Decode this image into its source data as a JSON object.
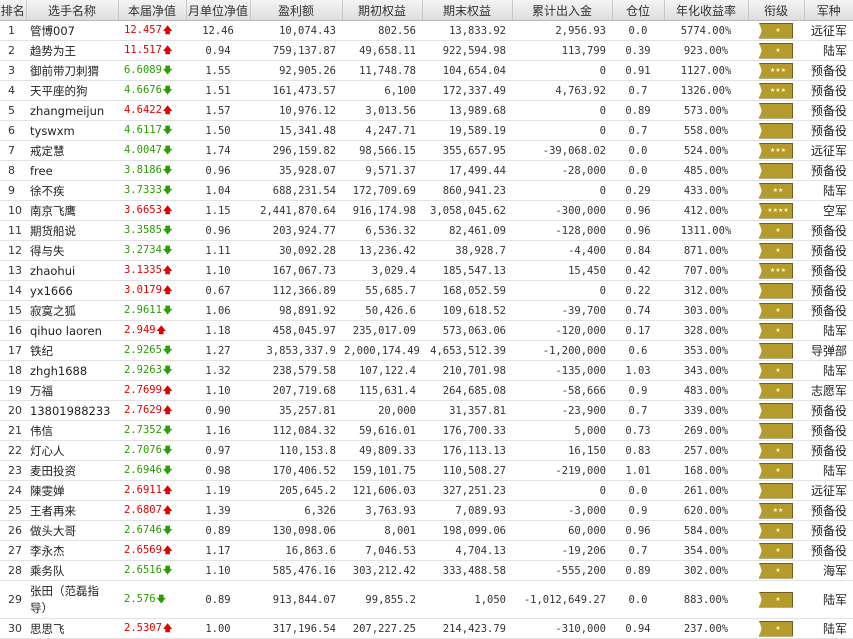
{
  "headers": [
    "排名",
    "选手名称",
    "本届净值",
    "月单位净值",
    "盈利额",
    "期初权益",
    "期末权益",
    "累计出入金",
    "仓位",
    "年化收益率",
    "衔级",
    "军种"
  ],
  "rows": [
    {
      "rank": "1",
      "name": "管博007",
      "nav": "12.457",
      "dir": "up",
      "monthly": "12.46",
      "profit": "10,074.43",
      "start": "802.56",
      "end": "13,833.92",
      "flow": "2,956.93",
      "position": "0.0",
      "annual": "5774.00%",
      "rank_stars": "★",
      "branch": "远征军"
    },
    {
      "rank": "2",
      "name": "趋势为王",
      "nav": "11.517",
      "dir": "up",
      "monthly": "0.94",
      "profit": "759,137.87",
      "start": "49,658.11",
      "end": "922,594.98",
      "flow": "113,799",
      "position": "0.39",
      "annual": "923.00%",
      "rank_stars": "★",
      "branch": "陆军"
    },
    {
      "rank": "3",
      "name": "御前带刀刺猬",
      "nav": "6.6089",
      "dir": "down",
      "monthly": "1.55",
      "profit": "92,905.26",
      "start": "11,748.78",
      "end": "104,654.04",
      "flow": "0",
      "position": "0.91",
      "annual": "1127.00%",
      "rank_stars": "★★★",
      "branch": "预备役"
    },
    {
      "rank": "4",
      "name": "天平座的狗",
      "nav": "4.6676",
      "dir": "down",
      "monthly": "1.51",
      "profit": "161,473.57",
      "start": "6,100",
      "end": "172,337.49",
      "flow": "4,763.92",
      "position": "0.7",
      "annual": "1326.00%",
      "rank_stars": "★★★",
      "branch": "预备役"
    },
    {
      "rank": "5",
      "name": "zhangmeijun",
      "nav": "4.6422",
      "dir": "up",
      "monthly": "1.57",
      "profit": "10,976.12",
      "start": "3,013.56",
      "end": "13,989.68",
      "flow": "0",
      "position": "0.89",
      "annual": "573.00%",
      "rank_stars": "",
      "branch": "预备役"
    },
    {
      "rank": "6",
      "name": "tyswxm",
      "nav": "4.6117",
      "dir": "down",
      "monthly": "1.50",
      "profit": "15,341.48",
      "start": "4,247.71",
      "end": "19,589.19",
      "flow": "0",
      "position": "0.7",
      "annual": "558.00%",
      "rank_stars": "",
      "branch": "预备役"
    },
    {
      "rank": "7",
      "name": "戒定慧",
      "nav": "4.0047",
      "dir": "down",
      "monthly": "1.74",
      "profit": "296,159.82",
      "start": "98,566.15",
      "end": "355,657.95",
      "flow": "-39,068.02",
      "position": "0.0",
      "annual": "524.00%",
      "rank_stars": "★★★",
      "branch": "远征军"
    },
    {
      "rank": "8",
      "name": "free",
      "nav": "3.8186",
      "dir": "down",
      "monthly": "0.96",
      "profit": "35,928.07",
      "start": "9,571.37",
      "end": "17,499.44",
      "flow": "-28,000",
      "position": "0.0",
      "annual": "485.00%",
      "rank_stars": "",
      "branch": "预备役"
    },
    {
      "rank": "9",
      "name": "徐不疾",
      "nav": "3.7333",
      "dir": "down",
      "monthly": "1.04",
      "profit": "688,231.54",
      "start": "172,709.69",
      "end": "860,941.23",
      "flow": "0",
      "position": "0.29",
      "annual": "433.00%",
      "rank_stars": "★★",
      "branch": "陆军"
    },
    {
      "rank": "10",
      "name": "南京飞鹰",
      "nav": "3.6653",
      "dir": "up",
      "monthly": "1.15",
      "profit": "2,441,870.64",
      "start": "916,174.98",
      "end": "3,058,045.62",
      "flow": "-300,000",
      "position": "0.96",
      "annual": "412.00%",
      "rank_stars": "★★★★",
      "branch": "空军"
    },
    {
      "rank": "11",
      "name": "期货船说",
      "nav": "3.3585",
      "dir": "down",
      "monthly": "0.96",
      "profit": "203,924.77",
      "start": "6,536.32",
      "end": "82,461.09",
      "flow": "-128,000",
      "position": "0.96",
      "annual": "1311.00%",
      "rank_stars": "★",
      "branch": "预备役"
    },
    {
      "rank": "12",
      "name": "得与失",
      "nav": "3.2734",
      "dir": "down",
      "monthly": "1.11",
      "profit": "30,092.28",
      "start": "13,236.42",
      "end": "38,928.7",
      "flow": "-4,400",
      "position": "0.84",
      "annual": "871.00%",
      "rank_stars": "★",
      "branch": "预备役"
    },
    {
      "rank": "13",
      "name": "zhaohui",
      "nav": "3.1335",
      "dir": "up",
      "monthly": "1.10",
      "profit": "167,067.73",
      "start": "3,029.4",
      "end": "185,547.13",
      "flow": "15,450",
      "position": "0.42",
      "annual": "707.00%",
      "rank_stars": "★★★",
      "branch": "预备役"
    },
    {
      "rank": "14",
      "name": "yx1666",
      "nav": "3.0179",
      "dir": "up",
      "monthly": "0.67",
      "profit": "112,366.89",
      "start": "55,685.7",
      "end": "168,052.59",
      "flow": "0",
      "position": "0.22",
      "annual": "312.00%",
      "rank_stars": "",
      "branch": "预备役"
    },
    {
      "rank": "15",
      "name": "寂寞之狐",
      "nav": "2.9611",
      "dir": "down",
      "monthly": "1.06",
      "profit": "98,891.92",
      "start": "50,426.6",
      "end": "109,618.52",
      "flow": "-39,700",
      "position": "0.74",
      "annual": "303.00%",
      "rank_stars": "★",
      "branch": "预备役"
    },
    {
      "rank": "16",
      "name": "qihuo laoren",
      "nav": "2.949",
      "dir": "up",
      "monthly": "1.18",
      "profit": "458,045.97",
      "start": "235,017.09",
      "end": "573,063.06",
      "flow": "-120,000",
      "position": "0.17",
      "annual": "328.00%",
      "rank_stars": "★",
      "branch": "陆军"
    },
    {
      "rank": "17",
      "name": "铁纪",
      "nav": "2.9265",
      "dir": "down",
      "monthly": "1.27",
      "profit": "3,853,337.9",
      "start": "2,000,174.49",
      "end": "4,653,512.39",
      "flow": "-1,200,000",
      "position": "0.6",
      "annual": "353.00%",
      "rank_stars": "",
      "branch": "导弹部"
    },
    {
      "rank": "18",
      "name": "zhgh1688",
      "nav": "2.9263",
      "dir": "down",
      "monthly": "1.32",
      "profit": "238,579.58",
      "start": "107,122.4",
      "end": "210,701.98",
      "flow": "-135,000",
      "position": "1.03",
      "annual": "343.00%",
      "rank_stars": "★",
      "branch": "陆军"
    },
    {
      "rank": "19",
      "name": "万福",
      "nav": "2.7699",
      "dir": "up",
      "monthly": "1.10",
      "profit": "207,719.68",
      "start": "115,631.4",
      "end": "264,685.08",
      "flow": "-58,666",
      "position": "0.9",
      "annual": "483.00%",
      "rank_stars": "★",
      "branch": "志愿军"
    },
    {
      "rank": "20",
      "name": "13801988233",
      "nav": "2.7629",
      "dir": "up",
      "monthly": "0.90",
      "profit": "35,257.81",
      "start": "20,000",
      "end": "31,357.81",
      "flow": "-23,900",
      "position": "0.7",
      "annual": "339.00%",
      "rank_stars": "",
      "branch": "预备役"
    },
    {
      "rank": "21",
      "name": "伟信",
      "nav": "2.7352",
      "dir": "down",
      "monthly": "1.16",
      "profit": "112,084.32",
      "start": "59,616.01",
      "end": "176,700.33",
      "flow": "5,000",
      "position": "0.73",
      "annual": "269.00%",
      "rank_stars": "",
      "branch": "预备役"
    },
    {
      "rank": "22",
      "name": "灯心人",
      "nav": "2.7076",
      "dir": "down",
      "monthly": "0.97",
      "profit": "110,153.8",
      "start": "49,809.33",
      "end": "176,113.13",
      "flow": "16,150",
      "position": "0.83",
      "annual": "257.00%",
      "rank_stars": "★",
      "branch": "预备役"
    },
    {
      "rank": "23",
      "name": "麦田投资",
      "nav": "2.6946",
      "dir": "down",
      "monthly": "0.98",
      "profit": "170,406.52",
      "start": "159,101.75",
      "end": "110,508.27",
      "flow": "-219,000",
      "position": "1.01",
      "annual": "168.00%",
      "rank_stars": "★",
      "branch": "陆军"
    },
    {
      "rank": "24",
      "name": "陳雯婵",
      "nav": "2.6911",
      "dir": "up",
      "monthly": "1.19",
      "profit": "205,645.2",
      "start": "121,606.03",
      "end": "327,251.23",
      "flow": "0",
      "position": "0.0",
      "annual": "261.00%",
      "rank_stars": "",
      "branch": "远征军"
    },
    {
      "rank": "25",
      "name": "王者再来",
      "nav": "2.6807",
      "dir": "up",
      "monthly": "1.39",
      "profit": "6,326",
      "start": "3,763.93",
      "end": "7,089.93",
      "flow": "-3,000",
      "position": "0.9",
      "annual": "620.00%",
      "rank_stars": "★★",
      "branch": "预备役"
    },
    {
      "rank": "26",
      "name": "做头大哥",
      "nav": "2.6746",
      "dir": "down",
      "monthly": "0.89",
      "profit": "130,098.06",
      "start": "8,001",
      "end": "198,099.06",
      "flow": "60,000",
      "position": "0.96",
      "annual": "584.00%",
      "rank_stars": "★",
      "branch": "预备役"
    },
    {
      "rank": "27",
      "name": "李永杰",
      "nav": "2.6569",
      "dir": "up",
      "monthly": "1.17",
      "profit": "16,863.6",
      "start": "7,046.53",
      "end": "4,704.13",
      "flow": "-19,206",
      "position": "0.7",
      "annual": "354.00%",
      "rank_stars": "★",
      "branch": "预备役"
    },
    {
      "rank": "28",
      "name": "乘务队",
      "nav": "2.6516",
      "dir": "down",
      "monthly": "1.10",
      "profit": "585,476.16",
      "start": "303,212.42",
      "end": "333,488.58",
      "flow": "-555,200",
      "position": "0.89",
      "annual": "302.00%",
      "rank_stars": "★",
      "branch": "海军"
    },
    {
      "rank": "29",
      "name": "张田（范磊指导）",
      "nav": "2.576",
      "dir": "down",
      "monthly": "0.89",
      "profit": "913,844.07",
      "start": "99,855.2",
      "end": "1,050",
      "flow": "-1,012,649.27",
      "position": "0.0",
      "annual": "883.00%",
      "rank_stars": "★",
      "branch": "陆军"
    },
    {
      "rank": "30",
      "name": "思思飞",
      "nav": "2.5307",
      "dir": "up",
      "monthly": "1.00",
      "profit": "317,196.54",
      "start": "207,227.25",
      "end": "214,423.79",
      "flow": "-310,000",
      "position": "0.94",
      "annual": "237.00%",
      "rank_stars": "★",
      "branch": "陆军"
    }
  ]
}
